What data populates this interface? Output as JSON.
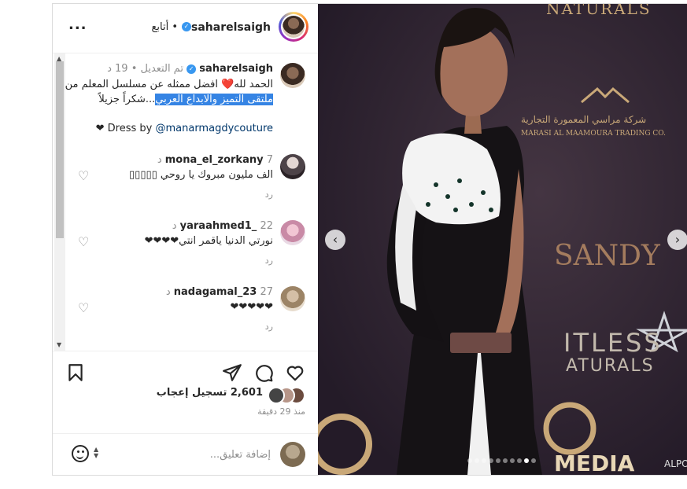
{
  "post": {
    "header": {
      "username": "saharelsaigh",
      "follow_label": "أتابع",
      "separator": "•",
      "more_label": "..."
    },
    "caption": {
      "username": "saharelsaigh",
      "edited": "تم التعديل",
      "time": "19 د",
      "line1": "الحمد لله❤️ افضل ممثله عن مسلسل المعلم من",
      "line2_highlight": "ملتقى التميز والابداع العربي",
      "line2_rest": "...شكراً جزيلاً",
      "dress_prefix": "❤ Dress by",
      "dress_link": "@manarmagdycouture"
    },
    "comments": [
      {
        "username": "mona_el_zorkany",
        "time": "7 د",
        "text": "الف مليون مبروك يا روحي ▯▯▯▯▯",
        "reply": "رد"
      },
      {
        "username": "yaraahmed1_",
        "time": "22 د",
        "text": "نورتي الدنيا ياقمر انتي❤❤❤❤",
        "reply": "رد"
      },
      {
        "username": "nadagamal_23",
        "time": "27 د",
        "text": "❤❤❤❤❤",
        "reply": "رد"
      }
    ],
    "likes": {
      "count_text": "2,601 تسجيل إعجاب"
    },
    "time_ago": "منذ 29 دقيقة",
    "add_comment_placeholder": "إضافة تعليق...",
    "icons": {
      "like": "heart-icon",
      "comment": "comment-icon",
      "share": "share-icon",
      "save": "bookmark-icon",
      "emoji": "emoji-icon"
    },
    "carousel": {
      "total": 10,
      "active": 9,
      "prev_label": "‹",
      "next_label": "›"
    },
    "photo_text": {
      "naturals_top": "NATURALS",
      "marasi_ar": "شركة مراسي المعمورة التجارية",
      "marasi_en": "MARASI AL MAAMOURA TRADING CO.",
      "sandy": "SANDY",
      "itless": "ITLESS",
      "naturals_bottom": "ATURALS",
      "media": "MEDIA",
      "alpo": "ALPO"
    },
    "colors": {
      "accent": "#3897f0",
      "link": "#00376b",
      "muted": "#8e8e8e",
      "highlight": "#3584e4"
    }
  }
}
